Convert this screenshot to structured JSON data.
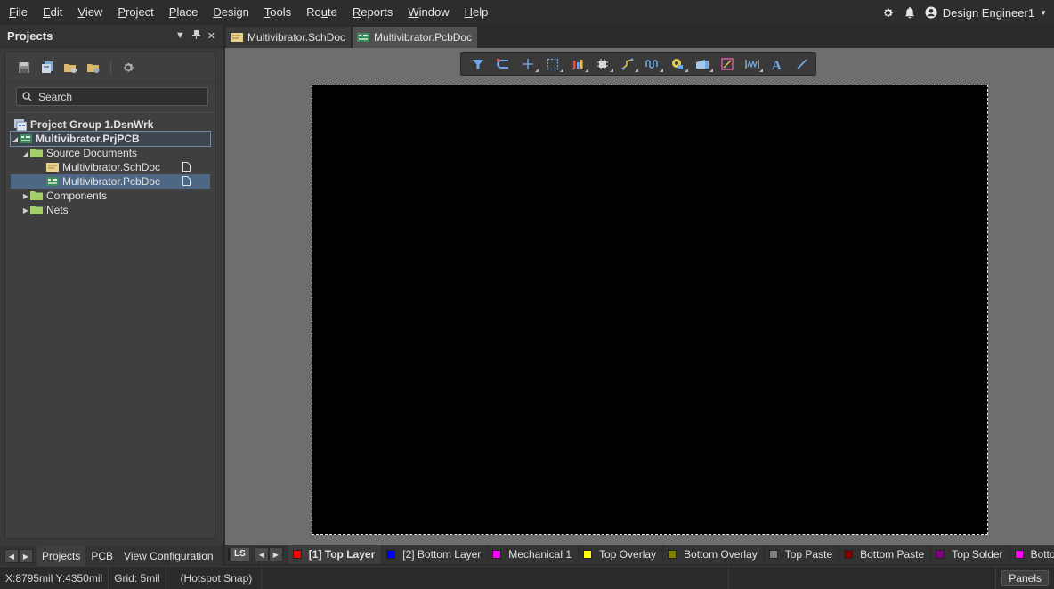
{
  "menu": {
    "items": [
      {
        "pre": "",
        "u": "F",
        "post": "ile"
      },
      {
        "pre": "",
        "u": "E",
        "post": "dit"
      },
      {
        "pre": "",
        "u": "V",
        "post": "iew"
      },
      {
        "pre": "",
        "u": "P",
        "post": "roject"
      },
      {
        "pre": "",
        "u": "P",
        "post": "lace"
      },
      {
        "pre": "",
        "u": "D",
        "post": "esign"
      },
      {
        "pre": "",
        "u": "T",
        "post": "ools"
      },
      {
        "pre": "Ro",
        "u": "u",
        "post": "te"
      },
      {
        "pre": "",
        "u": "R",
        "post": "eports"
      },
      {
        "pre": "",
        "u": "W",
        "post": "indow"
      },
      {
        "pre": "",
        "u": "H",
        "post": "elp"
      }
    ],
    "user_name": "Design Engineer1"
  },
  "projects_panel": {
    "title": "Projects",
    "search_placeholder": "Search",
    "tree": {
      "group": "Project Group 1.DsnWrk",
      "project": "Multivibrator.PrjPCB",
      "source_folder": "Source Documents",
      "sch_doc": "Multivibrator.SchDoc",
      "pcb_doc": "Multivibrator.PcbDoc",
      "components": "Components",
      "nets": "Nets"
    },
    "tabs": [
      "Projects",
      "PCB",
      "View Configuration"
    ]
  },
  "doc_tabs": [
    {
      "label": "Multivibrator.SchDoc",
      "active": false
    },
    {
      "label": "Multivibrator.PcbDoc",
      "active": true
    }
  ],
  "layer_bar": {
    "ls_label": "LS",
    "layers": [
      {
        "name": "[1] Top Layer",
        "color": "#ff0000",
        "active": true
      },
      {
        "name": "[2] Bottom Layer",
        "color": "#0000ff",
        "active": false
      },
      {
        "name": "Mechanical 1",
        "color": "#ff00ff",
        "active": false
      },
      {
        "name": "Top Overlay",
        "color": "#ffff00",
        "active": false
      },
      {
        "name": "Bottom Overlay",
        "color": "#808000",
        "active": false
      },
      {
        "name": "Top Paste",
        "color": "#808080",
        "active": false
      },
      {
        "name": "Bottom Paste",
        "color": "#800000",
        "active": false
      },
      {
        "name": "Top Solder",
        "color": "#800080",
        "active": false
      },
      {
        "name": "Bottom Solder",
        "color": "#ff00ff",
        "active": false
      }
    ]
  },
  "status": {
    "coords": "X:8795mil Y:4350mil",
    "grid": "Grid: 5mil",
    "snap": "(Hotspot Snap)",
    "panels_button": "Panels"
  }
}
